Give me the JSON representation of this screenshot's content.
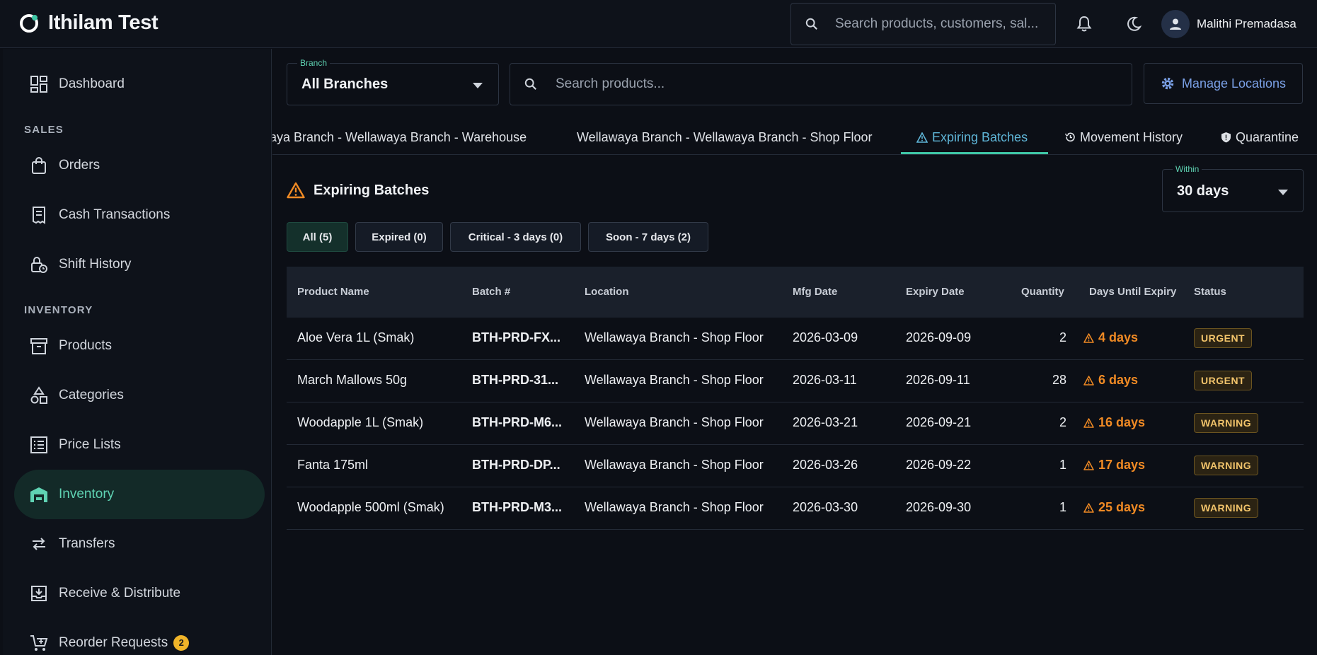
{
  "app": {
    "title": "Ithilam Test"
  },
  "header": {
    "search_placeholder": "Search products, customers, sal...",
    "user_name": "Malithi Premadasa"
  },
  "sidebar": {
    "dashboard": "Dashboard",
    "sections": {
      "sales": "SALES",
      "inventory": "INVENTORY"
    },
    "items": [
      {
        "label": "Orders"
      },
      {
        "label": "Cash Transactions"
      },
      {
        "label": "Shift History"
      },
      {
        "label": "Products"
      },
      {
        "label": "Categories"
      },
      {
        "label": "Price Lists"
      },
      {
        "label": "Inventory"
      },
      {
        "label": "Transfers"
      },
      {
        "label": "Receive & Distribute"
      },
      {
        "label": "Reorder Requests",
        "badge": "2"
      }
    ]
  },
  "toolbar": {
    "branch_label": "Branch",
    "branch_value": "All Branches",
    "search_placeholder": "Search products...",
    "manage_label": "Manage Locations"
  },
  "tabs": [
    {
      "label": "aya Branch - Wellawaya Branch - Warehouse"
    },
    {
      "label": "Wellawaya Branch - Wellawaya Branch - Shop Floor"
    },
    {
      "label": "Expiring Batches"
    },
    {
      "label": "Movement History"
    },
    {
      "label": "Quarantine"
    }
  ],
  "panel": {
    "title": "Expiring Batches",
    "within_label": "Within",
    "within_value": "30 days",
    "filters": [
      "All (5)",
      "Expired (0)",
      "Critical - 3 days (0)",
      "Soon - 7 days (2)"
    ]
  },
  "table": {
    "headers": [
      "Product Name",
      "Batch #",
      "Location",
      "Mfg Date",
      "Expiry Date",
      "Quantity",
      "Days Until Expiry",
      "Status"
    ],
    "rows": [
      {
        "product": "Aloe Vera 1L (Smak)",
        "batch": "BTH-PRD-FX...",
        "location": "Wellawaya Branch - Shop Floor",
        "mfg": "2026-03-09",
        "expiry": "2026-09-09",
        "qty": "2",
        "days": "4 days",
        "status": "URGENT"
      },
      {
        "product": "March Mallows 50g",
        "batch": "BTH-PRD-31...",
        "location": "Wellawaya Branch - Shop Floor",
        "mfg": "2026-03-11",
        "expiry": "2026-09-11",
        "qty": "28",
        "days": "6 days",
        "status": "URGENT"
      },
      {
        "product": "Woodapple 1L (Smak)",
        "batch": "BTH-PRD-M6...",
        "location": "Wellawaya Branch - Shop Floor",
        "mfg": "2026-03-21",
        "expiry": "2026-09-21",
        "qty": "2",
        "days": "16 days",
        "status": "WARNING"
      },
      {
        "product": "Fanta 175ml",
        "batch": "BTH-PRD-DP...",
        "location": "Wellawaya Branch - Shop Floor",
        "mfg": "2026-03-26",
        "expiry": "2026-09-22",
        "qty": "1",
        "days": "17 days",
        "status": "WARNING"
      },
      {
        "product": "Woodapple 500ml (Smak)",
        "batch": "BTH-PRD-M3...",
        "location": "Wellawaya Branch - Shop Floor",
        "mfg": "2026-03-30",
        "expiry": "2026-09-30",
        "qty": "1",
        "days": "25 days",
        "status": "WARNING"
      }
    ]
  },
  "colors": {
    "accent": "#3fc7a6",
    "warning": "#f08a24",
    "link": "#7aa0e6"
  }
}
